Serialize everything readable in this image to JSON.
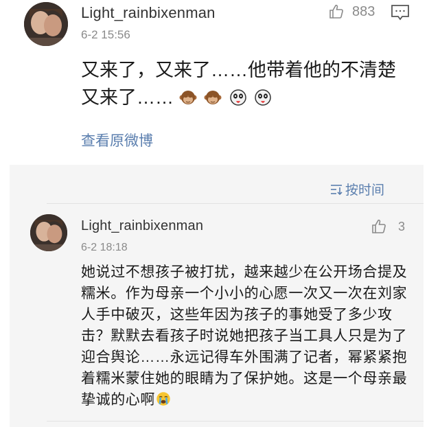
{
  "post": {
    "username": "Light_rainbixenman",
    "time": "6-2 15:56",
    "likes": "883",
    "text_line1": "又来了，又来了……他带着他的不清楚",
    "text_line2": "又来了……",
    "emojis": [
      "monkey-icon",
      "monkey-icon",
      "panda-icon",
      "panda-icon"
    ],
    "view_original": "查看原微博"
  },
  "sort": {
    "label": "按时间"
  },
  "reply": {
    "username": "Light_rainbixenman",
    "time": "6-2 18:18",
    "likes": "3",
    "text": "她说过不想孩子被打扰，越来越少在公开场合提及糯米。作为母亲一个小小的心愿一次又一次在刘家人手中破灭，这些年因为孩子的事她受了多少攻击？默默去看孩子时说她把孩子当工具人只是为了迎合舆论……永远记得车外围满了记者，幂紧紧抱着糯米蒙住她的眼睛为了保护她。这是一个母亲最挚诚的心啊",
    "trailing_emoji": "crying-face-icon"
  },
  "colors": {
    "link": "#5a7eae",
    "meta": "#8a8a8a",
    "panel": "#f5f5f5"
  }
}
